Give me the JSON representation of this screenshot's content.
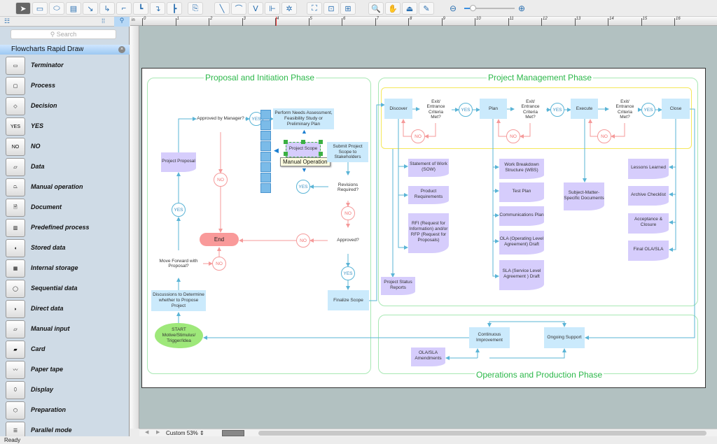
{
  "toolbar": {
    "tools": [
      "pointer-tool",
      "rectangle-tool",
      "ellipse-tool",
      "text-tool",
      "connector-tool",
      "smart-connector-tool",
      "round-connector-tool",
      "orthogonal-connector-tool",
      "curved-connector-tool",
      "tree-connector-tool",
      "insert-tool",
      "line-tool",
      "arc-tool",
      "bezier-tool",
      "polyline-tool",
      "spline-tool",
      "chain-tool",
      "snap-tool",
      "group-tool",
      "zoom-tool",
      "pan-tool",
      "stamp-tool",
      "eyedropper-tool"
    ],
    "zoom_slider_percent": 15
  },
  "panel": {
    "search_placeholder": "Search",
    "library_title": "Flowcharts Rapid Draw",
    "items": [
      "Terminator",
      "Process",
      "Decision",
      "YES",
      "NO",
      "Data",
      "Manual operation",
      "Document",
      "Predefined process",
      "Stored data",
      "Internal storage",
      "Sequential data",
      "Direct data",
      "Manual input",
      "Card",
      "Paper tape",
      "Display",
      "Preparation",
      "Parallel mode"
    ]
  },
  "ruler": {
    "unit": "in",
    "ticks": [
      "0",
      "1",
      "2",
      "3",
      "4",
      "5",
      "6",
      "7",
      "8",
      "9",
      "10",
      "11",
      "12",
      "13",
      "14",
      "15",
      "16"
    ]
  },
  "diagram": {
    "phases": {
      "initiation": "Proposal and Initiation Phase",
      "management": "Project Management Phase",
      "operations": "Operations and Production Phase"
    },
    "yes": "YES",
    "no": "NO",
    "end": "End",
    "initiation": {
      "approved_manager": "Approved by Manager?",
      "perform_needs": "Perform Needs Assessment, Feasibility Study or Preliminary Plan",
      "project_scope": "Project Scope",
      "tooltip": "Manual Operation",
      "submit_scope": "Submit Project Scope to Stakeholders",
      "revisions": "Revisions Required?",
      "approved": "Approved?",
      "finalize": "Finalize Scope",
      "proposal": "Project Proposal",
      "move_forward": "Move Forward with Proposal?",
      "discussions": "Discussions to Determine whether to Propose Project",
      "start": "START Motive/Stimulus/ Trigger/Idea"
    },
    "management": {
      "discover": "Discover",
      "plan": "Plan",
      "execute": "Execute",
      "close": "Close",
      "criteria": "Exit/ Entrance Criteria Met?",
      "discover_docs": [
        "Statement of Work (SOW)",
        "Product Requirements",
        "RFI (Request for Information) and/or RFP (Request for Proposals)"
      ],
      "status_reports": "Project Status Reports",
      "plan_docs": [
        "Work Breakdown Structure (WBS)",
        "Test Plan",
        "Communications Plan",
        "OLA (Operating Level Agreement) Draft",
        "SLA (Service Level Agreement ) Draft"
      ],
      "execute_doc": "Subject-Matter-Specific Documents",
      "close_docs": [
        "Lessons Learned",
        "Archive Checklist",
        "Acceptance & Closure",
        "Final OLA/SLA"
      ]
    },
    "operations": {
      "continuous": "Continuous Improvement",
      "ongoing": "Ongoing Support",
      "amendments": "OLA/SLA Amendments"
    }
  },
  "footer": {
    "zoom": "Custom 53%",
    "status": "Ready"
  },
  "colors": {
    "process": "#cbeafc",
    "document": "#d6cdfc",
    "decision": "#fdf28f",
    "end": "#f99a9a",
    "start": "#9ee87a",
    "flow": "#5ab4d6",
    "no_flow": "#f59a9a",
    "phase_title": "#2cb84a"
  }
}
